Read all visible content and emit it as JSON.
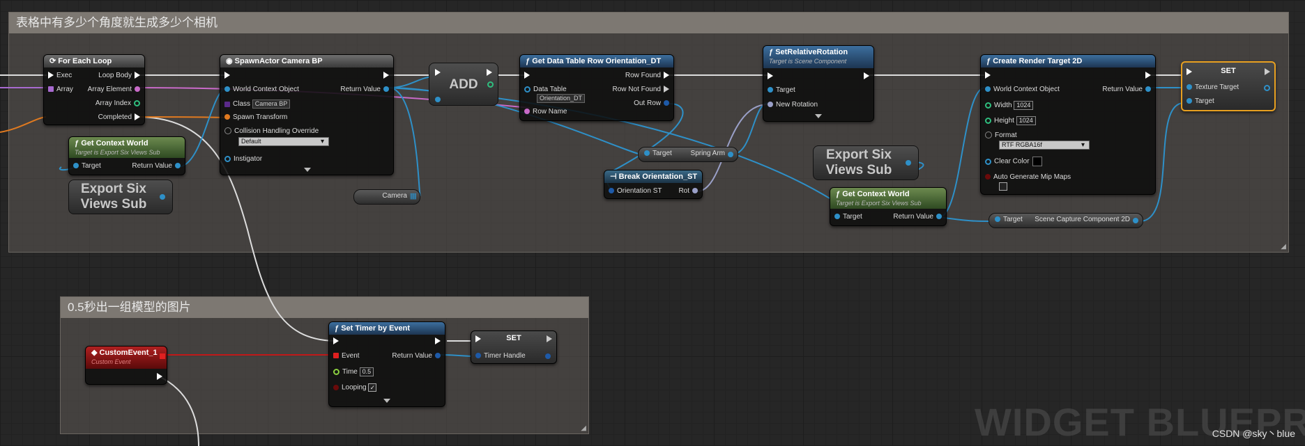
{
  "graph_label": "WIDGET BLUEPRINT",
  "credit": "CSDN @sky丶blue",
  "comments": {
    "top": "表格中有多少个角度就生成多少个相机",
    "bottom": "0.5秒出一组模型的图片"
  },
  "for_each_loop": {
    "title": "For Each Loop",
    "exec": "Exec",
    "array": "Array",
    "loop_body": "Loop Body",
    "array_element": "Array Element",
    "array_index": "Array Index",
    "completed": "Completed"
  },
  "get_context_world_1": {
    "title": "Get Context World",
    "subtitle": "Target is Export Six Views Sub",
    "target": "Target",
    "return_value": "Return Value"
  },
  "export_six_1": "Export Six Views Sub",
  "spawn_actor": {
    "title": "SpawnActor Camera BP",
    "world_context": "World Context Object",
    "return_value": "Return Value",
    "class": "Class",
    "class_value": "Camera BP",
    "spawn_transform": "Spawn Transform",
    "collision": "Collision Handling Override",
    "collision_value": "Default",
    "instigator": "Instigator"
  },
  "add_node": "ADD",
  "camera_var": "Camera",
  "get_data_table_row": {
    "title": "Get Data Table Row Orientation_DT",
    "data_table": "Data Table",
    "data_table_value": "Orientation_DT",
    "row_found": "Row Found",
    "row_not_found": "Row Not Found",
    "out_row": "Out Row",
    "row_name": "Row Name"
  },
  "spring_arm_var": {
    "target": "Target",
    "label": "Spring Arm"
  },
  "break_orientation": {
    "title": "Break Orientation_ST",
    "input": "Orientation ST",
    "rot": "Rot"
  },
  "set_relative_rotation": {
    "title": "SetRelativeRotation",
    "subtitle": "Target is Scene Component",
    "target": "Target",
    "new_rotation": "New Rotation"
  },
  "export_six_2": "Export Six Views Sub",
  "get_context_world_2": {
    "title": "Get Context World",
    "subtitle": "Target is Export Six Views Sub",
    "target": "Target",
    "return_value": "Return Value"
  },
  "create_render_target": {
    "title": "Create Render Target 2D",
    "world_context": "World Context Object",
    "return_value": "Return Value",
    "width": "Width",
    "width_value": "1024",
    "height": "Height",
    "height_value": "1024",
    "format": "Format",
    "format_value": "RTF RGBA16f",
    "clear_color": "Clear Color",
    "auto_mip": "Auto Generate Mip Maps"
  },
  "scene_capture_var": {
    "target": "Target",
    "label": "Scene Capture Component 2D"
  },
  "set_texture": {
    "title": "SET",
    "texture_target": "Texture Target",
    "target": "Target"
  },
  "custom_event": {
    "title": "CustomEvent_1",
    "subtitle": "Custom Event"
  },
  "set_timer": {
    "title": "Set Timer by Event",
    "event": "Event",
    "return_value": "Return Value",
    "time": "Time",
    "time_value": "0.5",
    "looping": "Looping",
    "looping_checked": "✓"
  },
  "set_timer_handle": {
    "title": "SET",
    "timer_handle": "Timer Handle"
  }
}
